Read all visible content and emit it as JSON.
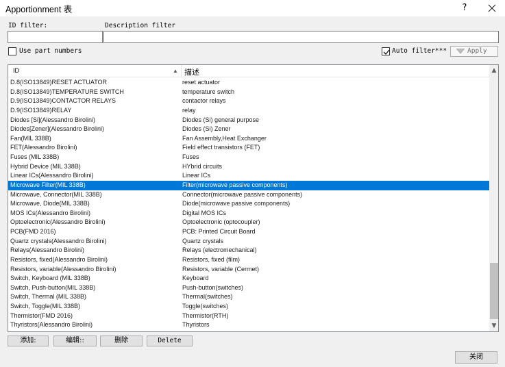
{
  "window": {
    "title": "Apportionment 表",
    "help_label": "?"
  },
  "filters": {
    "id_label": "ID filter:",
    "desc_label": "Description filter",
    "id_value": "",
    "desc_value": "",
    "use_part_numbers_label": "Use part numbers",
    "use_part_numbers_checked": false,
    "auto_filter_label": "Auto filter***",
    "auto_filter_checked": true,
    "apply_label": "Apply"
  },
  "table": {
    "columns": [
      "ID",
      "描述"
    ],
    "sort_indicator": "▲",
    "selected_index": 11,
    "rows": [
      [
        "D.8(ISO13849)RESET ACTUATOR",
        "reset actuator"
      ],
      [
        "D.8(ISO13849)TEMPERATURE SWITCH",
        "temperature switch"
      ],
      [
        "D.9(ISO13849)CONTACTOR RELAYS",
        "contactor relays"
      ],
      [
        "D.9(ISO13849)RELAY",
        "relay"
      ],
      [
        "Diodes [Si](Alessandro Birolini)",
        "Diodes (Si) general purpose"
      ],
      [
        "Diodes[Zener](Alessandro Birolini)",
        "Diodes (Si) Zener"
      ],
      [
        "Fan(MIL 338B)",
        "Fan Assembly,Heat Exchanger"
      ],
      [
        "FET(Alessandro Birolini)",
        "Field effect transistors (FET)"
      ],
      [
        "Fuses (MIL 338B)",
        "Fuses"
      ],
      [
        "Hybrid Device (MIL 338B)",
        "HYbrid circuits"
      ],
      [
        "Linear ICs(Alessandro Birolini)",
        "Linear ICs"
      ],
      [
        "Microwave Filter(MIL 338B)",
        "Filter(microwave passive components)"
      ],
      [
        "Microwave, Connector(MIL 338B)",
        "Connector(microwave passive components)"
      ],
      [
        "Microwave, Diode(MIL 338B)",
        "Diode(microwave passive components)"
      ],
      [
        "MOS ICs(Alessandro Birolini)",
        "Digital MOS ICs"
      ],
      [
        "Optoelectronic(Alessandro Birolini)",
        "Optoelectronic (optocoupler)"
      ],
      [
        "PCB(FMD 2016)",
        "PCB: Printed Circuit Board"
      ],
      [
        "Quartz crystals(Alessandro Birolini)",
        "Quartz crystals"
      ],
      [
        "Relays(Alessandro Birolini)",
        "Relays (electromechanical)"
      ],
      [
        "Resistors, fixed(Alessandro Birolini)",
        "Resistors, fixed (film)"
      ],
      [
        "Resistors, variable(Alessandro Birolini)",
        "Resistors, variable (Cermet)"
      ],
      [
        "Switch, Keyboard (MIL 338B)",
        "Keyboard"
      ],
      [
        "Switch, Push-button(MIL 338B)",
        "Push-button(switches)"
      ],
      [
        "Switch, Thermal (MIL 338B)",
        "Thermal(switches)"
      ],
      [
        "Switch, Toggle(MIL 338B)",
        "Toggle(switches)"
      ],
      [
        "Thermistor(FMD 2016)",
        "Thermistor(RTH)"
      ],
      [
        "Thyristors(Alessandro Birolini)",
        "Thyristors"
      ]
    ]
  },
  "scrollbar": {
    "up_glyph": "▲",
    "down_glyph": "▼",
    "position": 0.86
  },
  "buttons": {
    "add": "添加:",
    "edit": "编辑::",
    "remove": "删除",
    "delete": "Delete",
    "close": "关闭"
  },
  "colors": {
    "selection": "#0078d7",
    "background": "#f0f0f0"
  }
}
